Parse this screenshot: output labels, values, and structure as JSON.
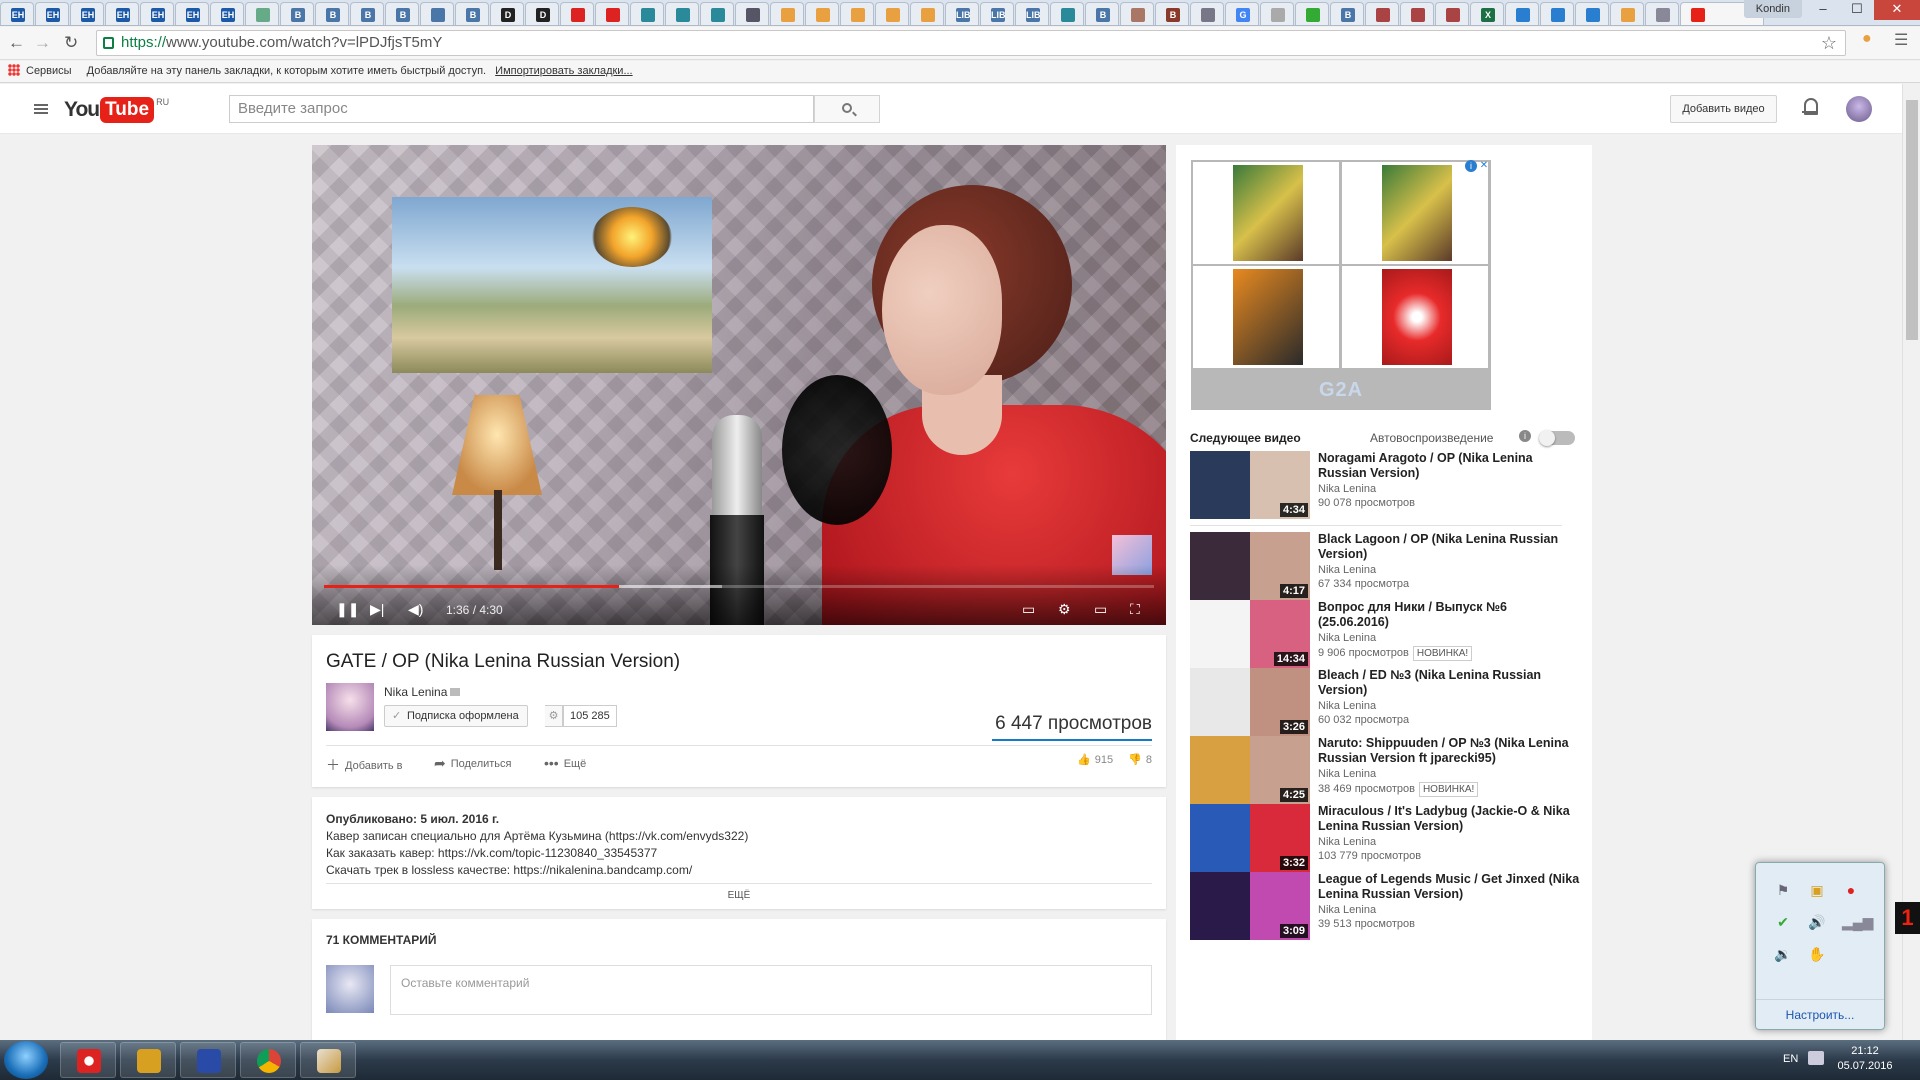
{
  "browser": {
    "tabs": [
      {
        "label": "EH",
        "color": "#1c5aa8"
      },
      {
        "label": "EH",
        "color": "#1c5aa8"
      },
      {
        "label": "EH",
        "color": "#1c5aa8"
      },
      {
        "label": "EH",
        "color": "#1c5aa8"
      },
      {
        "label": "EH",
        "color": "#1c5aa8"
      },
      {
        "label": "EH",
        "color": "#1c5aa8"
      },
      {
        "label": "EH",
        "color": "#1c5aa8"
      },
      {
        "label": "",
        "color": "#6a8"
      },
      {
        "label": "B",
        "color": "#4a76a8"
      },
      {
        "label": "B",
        "color": "#4a76a8"
      },
      {
        "label": "B",
        "color": "#4a76a8"
      },
      {
        "label": "B",
        "color": "#4a76a8"
      },
      {
        "label": "",
        "color": "#4a76a8"
      },
      {
        "label": "B",
        "color": "#4a76a8"
      },
      {
        "label": "D",
        "color": "#222"
      },
      {
        "label": "D",
        "color": "#222"
      },
      {
        "label": "",
        "color": "#d22"
      },
      {
        "label": "",
        "color": "#d22"
      },
      {
        "label": "",
        "color": "#2a8a9a"
      },
      {
        "label": "",
        "color": "#2a8a9a"
      },
      {
        "label": "",
        "color": "#2a8a9a"
      },
      {
        "label": "",
        "color": "#556"
      },
      {
        "label": "",
        "color": "#e8a040"
      },
      {
        "label": "",
        "color": "#e8a040"
      },
      {
        "label": "",
        "color": "#e8a040"
      },
      {
        "label": "",
        "color": "#e8a040"
      },
      {
        "label": "",
        "color": "#e8a040"
      },
      {
        "label": "LIB",
        "color": "#4a76a8"
      },
      {
        "label": "LIB",
        "color": "#4a76a8"
      },
      {
        "label": "LIB",
        "color": "#4a76a8"
      },
      {
        "label": "",
        "color": "#2a8a9a"
      },
      {
        "label": "B",
        "color": "#4a76a8"
      },
      {
        "label": "",
        "color": "#a76"
      },
      {
        "label": "B",
        "color": "#8a3a2a"
      },
      {
        "label": "",
        "color": "#778"
      },
      {
        "label": "G",
        "color": "#4285f4"
      },
      {
        "label": "",
        "color": "#aaa"
      },
      {
        "label": "",
        "color": "#3a3"
      },
      {
        "label": "B",
        "color": "#4a76a8"
      },
      {
        "label": "",
        "color": "#a44"
      },
      {
        "label": "",
        "color": "#a44"
      },
      {
        "label": "",
        "color": "#a44"
      },
      {
        "label": "X",
        "color": "#1d7044"
      },
      {
        "label": "",
        "color": "#2a7ed0"
      },
      {
        "label": "",
        "color": "#2a7ed0"
      },
      {
        "label": "",
        "color": "#2a7ed0"
      },
      {
        "label": "",
        "color": "#e8a040"
      },
      {
        "label": "",
        "color": "#889"
      }
    ],
    "user_label": "Kondin",
    "url_proto": "https://",
    "url_rest": "www.youtube.com/watch?v=lPDJfjsT5mY",
    "bookmarks_apps": "Сервисы",
    "bookmarks_hint": "Добавляйте на эту панель закладки, к которым хотите иметь быстрый доступ.",
    "bookmarks_import": "Импортировать закладки..."
  },
  "masthead": {
    "logo_you": "You",
    "logo_tube": "Tube",
    "logo_region": "RU",
    "search_placeholder": "Введите запрос",
    "upload_label": "Добавить видео"
  },
  "player": {
    "time": "1:36 / 4:30",
    "progress": 0.356,
    "buffered": 0.48
  },
  "video": {
    "title": "GATE / OP (Nika Lenina Russian Version)",
    "channel": "Nika Lenina",
    "subscribe_label": "Подписка оформлена",
    "subscriber_count": "105 285",
    "views": "6 447 просмотров",
    "add_label": "Добавить в",
    "share_label": "Поделиться",
    "more_label": "Ещё",
    "likes": "915",
    "dislikes": "8"
  },
  "description": {
    "published": "Опубликовано: 5 июл. 2016 г.",
    "lines": [
      "Кавер записан специально для Артёма Кузьмина (https://vk.com/envyds322)",
      "Как заказать кавер: https://vk.com/topic-11230840_33545377",
      "Скачать трек в lossless качестве: https://nikalenina.bandcamp.com/"
    ],
    "more": "ЕЩЁ"
  },
  "comments": {
    "header": "71 КОММЕНТАРИЙ",
    "placeholder": "Оставьте комментарий"
  },
  "ad": {
    "brand": "G2A"
  },
  "sidebar": {
    "next_label": "Следующее видео",
    "autoplay_label": "Автовоспроизведение",
    "related": [
      {
        "title": "Noragami Aragoto / OP (Nika Lenina Russian Version)",
        "channel": "Nika Lenina",
        "views": "90 078 просмотров",
        "duration": "4:34",
        "badge": "",
        "c1": "#2a3a5a",
        "c2": "#d8c0b0"
      },
      {
        "title": "Black Lagoon / OP (Nika Lenina Russian Version)",
        "channel": "Nika Lenina",
        "views": "67 334 просмотра",
        "duration": "4:17",
        "badge": "",
        "c1": "#3a2a3a",
        "c2": "#c8a090"
      },
      {
        "title": "Вопрос для Ники / Выпуск №6 (25.06.2016)",
        "channel": "Nika Lenina",
        "views": "9 906 просмотров",
        "duration": "14:34",
        "badge": "НОВИНКА!",
        "c1": "#f4f4f4",
        "c2": "#d86080"
      },
      {
        "title": "Bleach / ED №3 (Nika Lenina Russian Version)",
        "channel": "Nika Lenina",
        "views": "60 032 просмотра",
        "duration": "3:26",
        "badge": "",
        "c1": "#e8e8e8",
        "c2": "#c09080"
      },
      {
        "title": "Naruto: Shippuuden / OP №3 (Nika Lenina Russian Version ft jparecki95)",
        "channel": "Nika Lenina",
        "views": "38 469 просмотров",
        "duration": "4:25",
        "badge": "НОВИНКА!",
        "c1": "#d8a040",
        "c2": "#c8a090"
      },
      {
        "title": "Miraculous / It's Ladybug (Jackie-O & Nika Lenina Russian Version)",
        "channel": "Nika Lenina",
        "views": "103 779 просмотров",
        "duration": "3:32",
        "badge": "",
        "c1": "#2a5ab8",
        "c2": "#d82a3a"
      },
      {
        "title": "League of Legends Music / Get Jinxed (Nika Lenina Russian Version)",
        "channel": "Nika Lenina",
        "views": "39 513 просмотров",
        "duration": "3:09",
        "badge": "",
        "c1": "#2a1a4a",
        "c2": "#c04ab0"
      }
    ]
  },
  "tray": {
    "configure_label": "Настроить...",
    "badge": "1"
  },
  "taskbar": {
    "lang": "EN",
    "time": "21:12",
    "date": "05.07.2016"
  }
}
